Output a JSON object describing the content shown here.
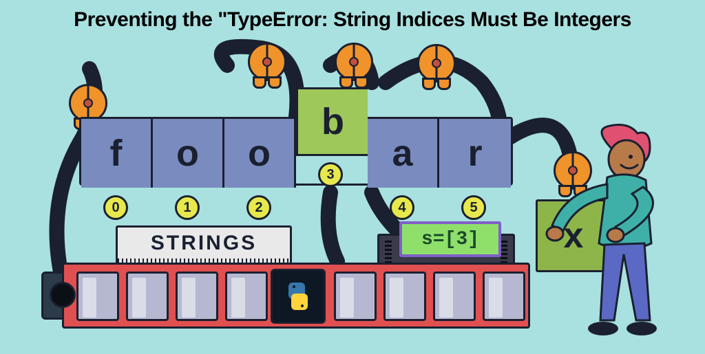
{
  "title": "Preventing the \"TypeError: String Indices Must Be Integers",
  "chars": [
    "f",
    "o",
    "o",
    "b",
    "a",
    "r"
  ],
  "indices": [
    "0",
    "1",
    "2",
    "3",
    "4",
    "5"
  ],
  "highlight_index": 3,
  "strings_label": "STRINGS",
  "display_code": "s=[3]",
  "x_box_label": "x",
  "icons": {
    "python": "python-logo",
    "claw": "claw-icon"
  },
  "colors": {
    "bg": "#a9e0e0",
    "cell": "#7a8cbf",
    "cell_highlight": "#9ec85a",
    "index_badge": "#e7e84c",
    "base": "#e05050",
    "claw": "#f0932b",
    "outline": "#1a2030"
  }
}
